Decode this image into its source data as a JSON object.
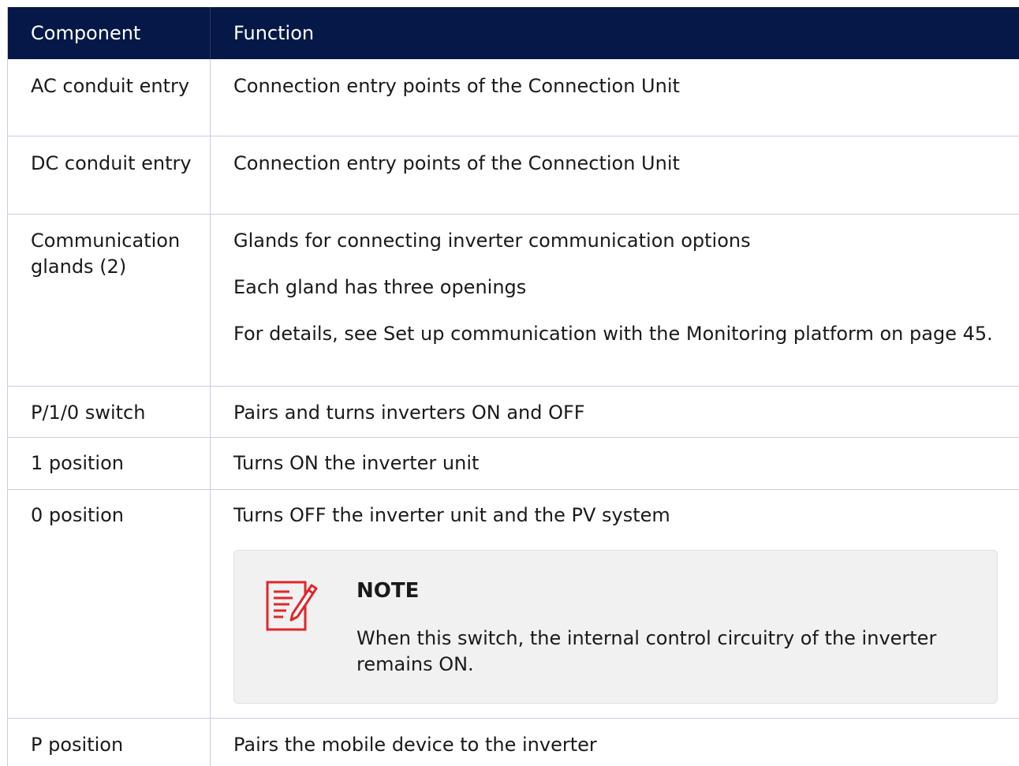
{
  "header": {
    "component": "Component",
    "function": "Function"
  },
  "rows": [
    {
      "component": "AC conduit entry",
      "function": "Connection entry points of the Connection Unit"
    },
    {
      "component": "DC conduit entry",
      "function": "Connection entry points of the Connection Unit"
    },
    {
      "component": "Communication glands (2)",
      "function_lines": [
        "Glands for connecting inverter communication options",
        "Each gland has three openings",
        "For details, see Set up communication with the Monitoring platform on page 45."
      ]
    },
    {
      "component": "P/1/0 switch",
      "function": "Pairs and turns inverters ON and OFF"
    },
    {
      "component": "1 position",
      "function": "Turns ON the inverter unit"
    },
    {
      "component": "0 position",
      "function": "Turns OFF the inverter unit and the PV system",
      "note": {
        "icon": "note-edit-icon",
        "title": "NOTE",
        "text": "When this switch, the internal control circuitry of the inverter remains ON."
      }
    },
    {
      "component": "P position",
      "function": "Pairs the mobile device to the inverter"
    }
  ],
  "colors": {
    "header_bg": "#061847",
    "header_text": "#ffffff",
    "border": "#c9cbe0",
    "note_bg": "#f1f1f1",
    "note_icon": "#e0262b"
  }
}
